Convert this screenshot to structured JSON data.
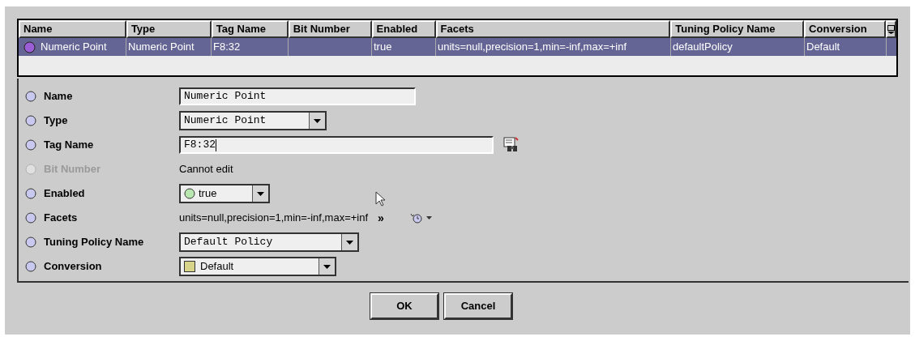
{
  "table": {
    "columns": [
      "Name",
      "Type",
      "Tag Name",
      "Bit Number",
      "Enabled",
      "Facets",
      "Tuning Policy Name",
      "Conversion"
    ],
    "rows": [
      {
        "selected": true,
        "cells": [
          "Numeric Point",
          "Numeric Point",
          "F8:32",
          "",
          "true",
          "units=null,precision=1,min=-inf,max=+inf",
          "defaultPolicy",
          "Default"
        ]
      }
    ]
  },
  "properties": [
    {
      "label": "Name",
      "disabled": false,
      "kind": "text",
      "value": "Numeric Point"
    },
    {
      "label": "Type",
      "disabled": false,
      "kind": "select",
      "value": "Numeric Point"
    },
    {
      "label": "Tag Name",
      "disabled": false,
      "kind": "tag",
      "value": "F8:32"
    },
    {
      "label": "Bit Number",
      "disabled": true,
      "kind": "note",
      "value": "Cannot edit"
    },
    {
      "label": "Enabled",
      "disabled": false,
      "kind": "status",
      "value": "true"
    },
    {
      "label": "Facets",
      "disabled": false,
      "kind": "facets",
      "value": "units=null,precision=1,min=-inf,max=+inf",
      "more": "»"
    },
    {
      "label": "Tuning Policy Name",
      "disabled": false,
      "kind": "select",
      "value": "Default Policy"
    },
    {
      "label": "Conversion",
      "disabled": false,
      "kind": "swatch",
      "value": "Default"
    }
  ],
  "buttons": [
    "OK",
    "Cancel"
  ]
}
